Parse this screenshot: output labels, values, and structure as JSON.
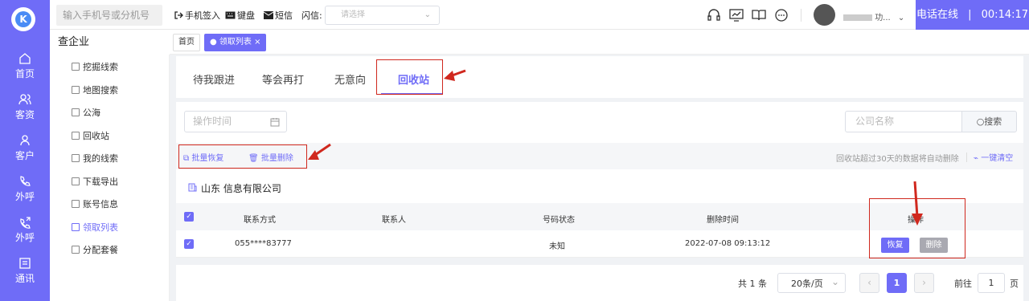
{
  "nav": {
    "items": [
      {
        "label": "首页",
        "icon": "home-icon"
      },
      {
        "label": "客资",
        "icon": "users-icon"
      },
      {
        "label": "客户",
        "icon": "user-icon"
      },
      {
        "label": "外呼",
        "icon": "phone-call-icon"
      },
      {
        "label": "外呼",
        "icon": "phone-outgoing-icon"
      },
      {
        "label": "通讯",
        "icon": "contacts-icon"
      }
    ]
  },
  "header": {
    "phone_placeholder": "输入手机号或分机号",
    "sign_in": "手机签入",
    "keypad": "键盘",
    "sms": "短信",
    "flash_label": "闪信:",
    "flash_placeholder": "请选择",
    "username": "功...",
    "online_label": "电话在线",
    "timer": "00:14:17"
  },
  "sidebar": {
    "title": "查企业",
    "items": [
      {
        "label": "挖掘线索"
      },
      {
        "label": "地图搜索"
      },
      {
        "label": "公海"
      },
      {
        "label": "回收站"
      },
      {
        "label": "我的线索"
      },
      {
        "label": "下载导出"
      },
      {
        "label": "账号信息"
      },
      {
        "label": "领取列表"
      },
      {
        "label": "分配套餐"
      }
    ]
  },
  "page_tabs": [
    {
      "label": "首页"
    },
    {
      "label": "● 领取列表 ×"
    }
  ],
  "filter_tabs": [
    {
      "label": "待我跟进"
    },
    {
      "label": "等会再打"
    },
    {
      "label": "无意向"
    },
    {
      "label": "回收站"
    }
  ],
  "filters": {
    "date_placeholder": "操作时间",
    "company_placeholder": "公司名称",
    "search_label": "搜索"
  },
  "actions": {
    "batch_restore": "批量恢复",
    "batch_delete": "批量删除",
    "notice": "回收站超过30天的数据将自动删除",
    "clear_all": "一键清空"
  },
  "company": {
    "name": "山东 信息有限公司"
  },
  "table": {
    "headers": [
      "联系方式",
      "联系人",
      "号码状态",
      "删除时间",
      "操作"
    ],
    "rows": [
      {
        "contact": "055****83777",
        "person": "",
        "status": "未知",
        "deleted_at": "2022-07-08 09:13:12",
        "restore": "恢复",
        "delete": "删除"
      }
    ]
  },
  "pagination": {
    "total": "共 1 条",
    "page_size": "20条/页",
    "current": "1",
    "goto_label": "前往",
    "goto_value": "1",
    "page_suffix": "页"
  },
  "colors": {
    "accent": "#6f6cf7",
    "annotation": "#d0281e",
    "restore_btn": "#6f6cf7",
    "delete_btn": "#a9a9b1"
  }
}
